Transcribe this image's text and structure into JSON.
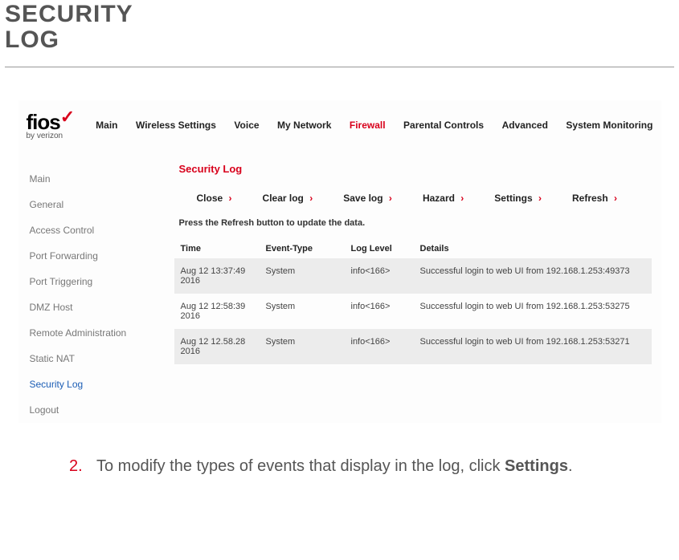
{
  "doc": {
    "title_line1": "SECURITY",
    "title_line2": "LOG"
  },
  "logo": {
    "brand": "fios",
    "byline": "by verizon"
  },
  "nav": {
    "items": [
      {
        "label": "Main"
      },
      {
        "label": "Wireless Settings"
      },
      {
        "label": "Voice"
      },
      {
        "label": "My Network"
      },
      {
        "label": "Firewall",
        "active": true
      },
      {
        "label": "Parental Controls"
      },
      {
        "label": "Advanced"
      },
      {
        "label": "System Monitoring"
      }
    ]
  },
  "sidebar": {
    "items": [
      {
        "label": "Main"
      },
      {
        "label": "General"
      },
      {
        "label": "Access Control"
      },
      {
        "label": "Port Forwarding"
      },
      {
        "label": "Port Triggering"
      },
      {
        "label": "DMZ Host"
      },
      {
        "label": "Remote Administration"
      },
      {
        "label": "Static NAT"
      },
      {
        "label": "Security Log",
        "active": true
      },
      {
        "label": "Logout"
      }
    ]
  },
  "panel": {
    "title": "Security Log",
    "actions": [
      {
        "label": "Close"
      },
      {
        "label": "Clear log"
      },
      {
        "label": "Save log"
      },
      {
        "label": "Hazard"
      },
      {
        "label": "Settings"
      },
      {
        "label": "Refresh"
      }
    ],
    "hint": "Press the Refresh button to update the data.",
    "columns": {
      "time": "Time",
      "type": "Event-Type",
      "level": "Log Level",
      "details": "Details"
    },
    "rows": [
      {
        "time": "Aug 12 13:37:49 2016",
        "type": "System",
        "level": "info<166>",
        "details": "Successful login to web UI from 192.168.1.253:49373"
      },
      {
        "time": "Aug 12 12:58:39 2016",
        "type": "System",
        "level": "info<166>",
        "details": "Successful login to web UI from 192.168.1.253:53275"
      },
      {
        "time": "Aug 12 12.58.28 2016",
        "type": "System",
        "level": "info<166>",
        "details": "Successful login to web UI from 192.168.1.253:53271"
      }
    ]
  },
  "step": {
    "num": "2.",
    "text_pre": "To modify the types of events that display in the log, click ",
    "text_bold": "Settings",
    "text_post": "."
  }
}
